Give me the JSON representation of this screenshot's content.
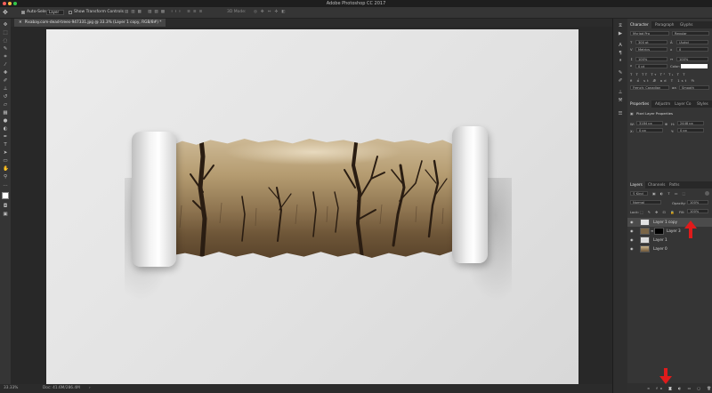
{
  "window": {
    "title": "Adobe Photoshop CC 2017"
  },
  "options_bar": {
    "auto_select_label": "Auto-Select:",
    "auto_select_value": "Layer",
    "show_transform_label": "Show Transform Controls",
    "mode_3d_label": "3D Mode:"
  },
  "document": {
    "tab_title": "Pixabay.com-dead-trees-947331.jpg @ 33.3% (Layer 1 copy, RGB/8#) *",
    "zoom": "33.33%",
    "doc_size": "Doc: 41.6M/286.4M"
  },
  "character_panel": {
    "tabs": [
      "Character",
      "Paragraph",
      "Glyphs"
    ],
    "font_family": "Myriad Pro",
    "font_style": "Regular",
    "font_size": "300 pt",
    "leading": "(Auto)",
    "kerning": "Metrics",
    "tracking": "0",
    "vertical_scale": "100%",
    "horizontal_scale": "100%",
    "baseline_shift": "0 pt",
    "color_label": "Color:",
    "language": "French: Canadian",
    "anti_alias": "Smooth"
  },
  "properties_panel": {
    "tabs": [
      "Properties",
      "Adjustm",
      "Layer Co",
      "Styles"
    ],
    "subtitle": "Pixel Layer Properties",
    "w_label": "W:",
    "w_value": "3184 px",
    "h_label": "H:",
    "h_value": "2448 px",
    "x_label": "X:",
    "x_value": "0 px",
    "y_label": "Y:",
    "y_value": "0 px"
  },
  "layers_panel": {
    "tabs": [
      "Layers",
      "Channels",
      "Paths"
    ],
    "filter": "Kind",
    "blend_mode": "Normal",
    "opacity_label": "Opacity:",
    "opacity": "100%",
    "lock_label": "Lock:",
    "fill_label": "Fill:",
    "fill": "100%",
    "layers": [
      {
        "name": "Layer 1 copy",
        "selected": true
      },
      {
        "name": "Layer 3",
        "selected": false
      },
      {
        "name": "Layer 1",
        "selected": false
      },
      {
        "name": "Layer 0",
        "selected": false
      }
    ]
  },
  "icons": {
    "tools": [
      "move-icon",
      "marquee-icon",
      "lasso-icon",
      "quick-select-icon",
      "crop-icon",
      "eyedropper-icon",
      "healing-icon",
      "brush-icon",
      "clone-stamp-icon",
      "history-brush-icon",
      "eraser-icon",
      "gradient-icon",
      "blur-icon",
      "dodge-icon",
      "pen-icon",
      "type-icon",
      "path-select-icon",
      "shape-icon",
      "hand-icon",
      "zoom-icon"
    ],
    "accent_arrow_color": "#e01b1b"
  }
}
